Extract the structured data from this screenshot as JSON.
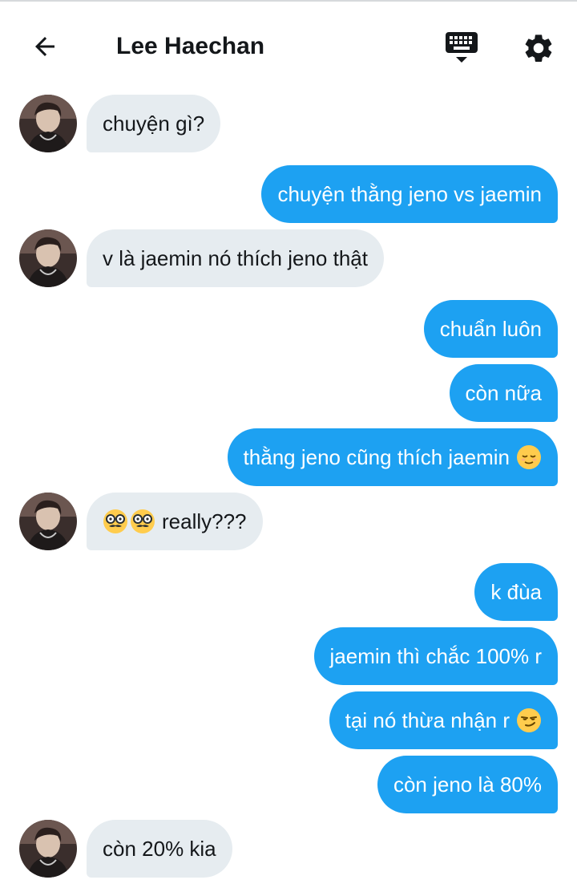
{
  "header": {
    "title": "Lee Haechan"
  },
  "icons": {
    "back": "arrow-left-icon",
    "keyboard": "keyboard-icon",
    "settings": "gear-icon"
  },
  "colors": {
    "outgoing_bubble": "#1da1f2",
    "incoming_bubble": "#e6ecf0"
  },
  "messages": [
    {
      "from": "contact",
      "text": "chuyện gì?"
    },
    {
      "from": "me",
      "text": "chuyện thằng jeno vs jaemin"
    },
    {
      "from": "contact",
      "text": "v là jaemin nó thích jeno thật"
    },
    {
      "from": "me",
      "text": "chuẩn luôn"
    },
    {
      "from": "me",
      "text": "còn nữa"
    },
    {
      "from": "me",
      "text": "thằng jeno cũng thích jaemin",
      "emoji": "relieved-face-emoji"
    },
    {
      "from": "contact",
      "text": "really???",
      "emoji": "disguised-face-emoji"
    },
    {
      "from": "me",
      "text": "k đùa"
    },
    {
      "from": "me",
      "text": "jaemin thì chắc 100% r"
    },
    {
      "from": "me",
      "text": "tại nó thừa nhận r",
      "emoji": "smirking-face-emoji"
    },
    {
      "from": "me",
      "text": "còn jeno là 80%"
    },
    {
      "from": "contact",
      "text": "còn 20% kia"
    }
  ]
}
